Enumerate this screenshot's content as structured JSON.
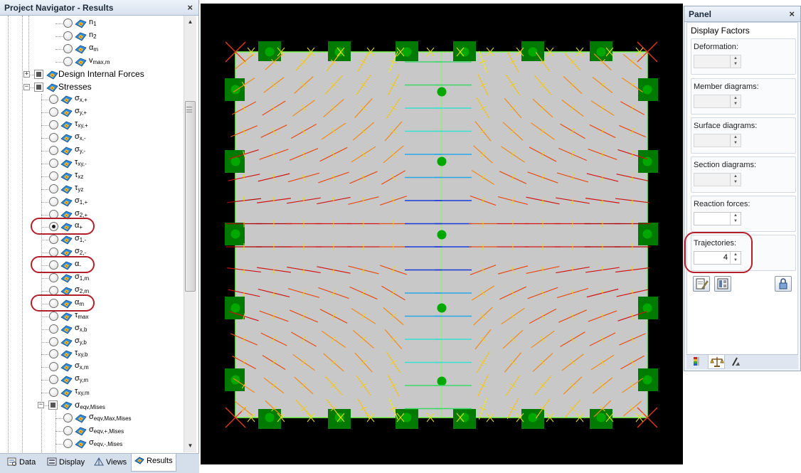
{
  "navigator": {
    "title": "Project Navigator - Results",
    "close": "×",
    "items": {
      "n1": {
        "base": "n",
        "sub": "1"
      },
      "n2": {
        "base": "n",
        "sub": "2"
      },
      "alpha_m_top": {
        "base": "α",
        "sub": "m"
      },
      "v_max_m": {
        "base": "v",
        "sub": "max,m"
      },
      "design_internal_forces": "Design Internal Forces",
      "stresses": "Stresses",
      "sx_plus": {
        "base": "σ",
        "sub": "x,+"
      },
      "sy_plus": {
        "base": "σ",
        "sub": "y,+"
      },
      "txy_plus": {
        "base": "τ",
        "sub": "xy,+"
      },
      "sx_minus": {
        "base": "σ",
        "sub": "x,-"
      },
      "sy_minus": {
        "base": "σ",
        "sub": "y,-"
      },
      "txy_minus": {
        "base": "τ",
        "sub": "xy,-"
      },
      "txz": {
        "base": "τ",
        "sub": "xz"
      },
      "tyz": {
        "base": "τ",
        "sub": "yz"
      },
      "s1_plus": {
        "base": "σ",
        "sub": "1,+"
      },
      "s2_plus": {
        "base": "σ",
        "sub": "2,+"
      },
      "alpha_plus": {
        "base": "α",
        "sub": "+"
      },
      "s1_minus": {
        "base": "σ",
        "sub": "1,-"
      },
      "s2_minus": {
        "base": "σ",
        "sub": "2,-"
      },
      "alpha_minus": {
        "base": "α",
        "sub": "-"
      },
      "s1_m": {
        "base": "σ",
        "sub": "1,m"
      },
      "s2_m": {
        "base": "σ",
        "sub": "2,m"
      },
      "alpha_m": {
        "base": "α",
        "sub": "m"
      },
      "tmax": {
        "base": "τ",
        "sub": "max"
      },
      "sx_b": {
        "base": "σ",
        "sub": "x,b"
      },
      "sy_b": {
        "base": "σ",
        "sub": "y,b"
      },
      "txy_b": {
        "base": "τ",
        "sub": "xy,b"
      },
      "sx_m": {
        "base": "σ",
        "sub": "x,m"
      },
      "sy_m": {
        "base": "σ",
        "sub": "y,m"
      },
      "txy_m": {
        "base": "τ",
        "sub": "xy,m"
      },
      "seqv_mises": {
        "base": "σ",
        "sub": "eqv,Mises"
      },
      "seqv_max_mises": {
        "base": "σ",
        "sub": "eqv,Max,Mises"
      },
      "seqv_plus_mises": {
        "base": "σ",
        "sub": "eqv,+,Mises"
      },
      "seqv_minus_mises": {
        "base": "σ",
        "sub": "eqv,-,Mises"
      }
    },
    "selected_item": "alpha_plus",
    "tabs": {
      "data": "Data",
      "display": "Display",
      "views": "Views",
      "results": "Results"
    },
    "active_tab": "Results"
  },
  "panel": {
    "title": "Panel",
    "close": "×",
    "section_title": "Display Factors",
    "groups": {
      "deformation": {
        "label": "Deformation:",
        "value": "",
        "enabled": false
      },
      "member_diagrams": {
        "label": "Member diagrams:",
        "value": "",
        "enabled": false
      },
      "surface_diagrams": {
        "label": "Surface diagrams:",
        "value": "",
        "enabled": false
      },
      "section_diagrams": {
        "label": "Section diagrams:",
        "value": "",
        "enabled": false
      },
      "reaction_forces": {
        "label": "Reaction forces:",
        "value": "",
        "enabled": true
      },
      "trajectories": {
        "label": "Trajectories:",
        "value": "4",
        "enabled": true
      }
    }
  },
  "colors": {
    "highlight": "#b3202a",
    "canvas_bg": "#000000",
    "plate": "#c8c8c8",
    "support": "#00a800",
    "support_block": "#007a00",
    "tab_strip": "#d5dfec"
  }
}
